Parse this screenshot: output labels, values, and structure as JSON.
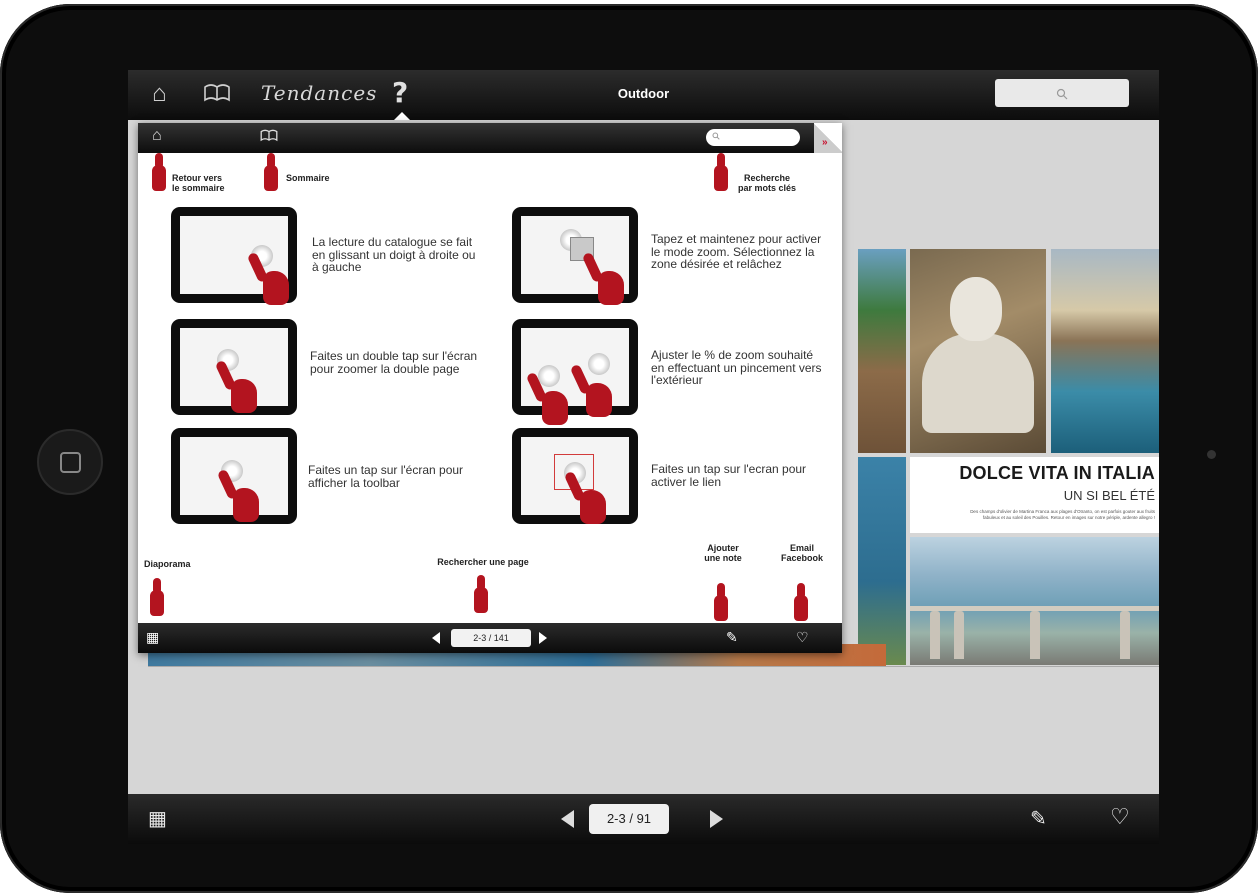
{
  "app": {
    "brand": "Tendances",
    "help_glyph": "?",
    "title": "Outdoor",
    "search_glyph": "⚲"
  },
  "magazine": {
    "headline": "DOLCE VITA IN ITALIA",
    "subhead": "UN SI BEL ÉTÉ",
    "body_small": "Des champs d'olivier de Martina Franca aux plages d'Otranto, on est parfois gouter aux fruits fabuleux et au soleil des Pouilles. Retour en images sur notre périple, ardente allegro !"
  },
  "help": {
    "labels": {
      "back_to_contents": "Retour vers\nle sommaire",
      "contents": "Sommaire",
      "search_keywords": "Recherche\npar mots clés",
      "slideshow": "Diaporama",
      "search_page": "Rechercher une page",
      "add_note": "Ajouter\nune note",
      "email_facebook": "Email\nFacebook"
    },
    "instructions": [
      "La lecture du catalogue se fait en glissant un doigt à droite ou à gauche",
      "Tapez et maintenez pour activer le mode zoom. Sélectionnez la zone désirée et relâchez",
      "Faites un double tap sur l'écran pour zoomer la double page",
      "Ajuster le % de zoom souhaité en effectuant un pincement vers l'extérieur",
      "Faites un tap sur l'écran pour afficher la toolbar",
      "Faites un tap sur l'ecran pour activer le lien"
    ],
    "pager": "2-3 / 141"
  },
  "bottombar": {
    "pager": "2-3 / 91"
  },
  "icons": {
    "home": "⌂",
    "book": "📖",
    "gallery": "▦",
    "note": "✎",
    "heart": "♡",
    "double_chevron": "»"
  },
  "colors": {
    "accent_red": "#b3141f",
    "toolbar": "#111111"
  }
}
